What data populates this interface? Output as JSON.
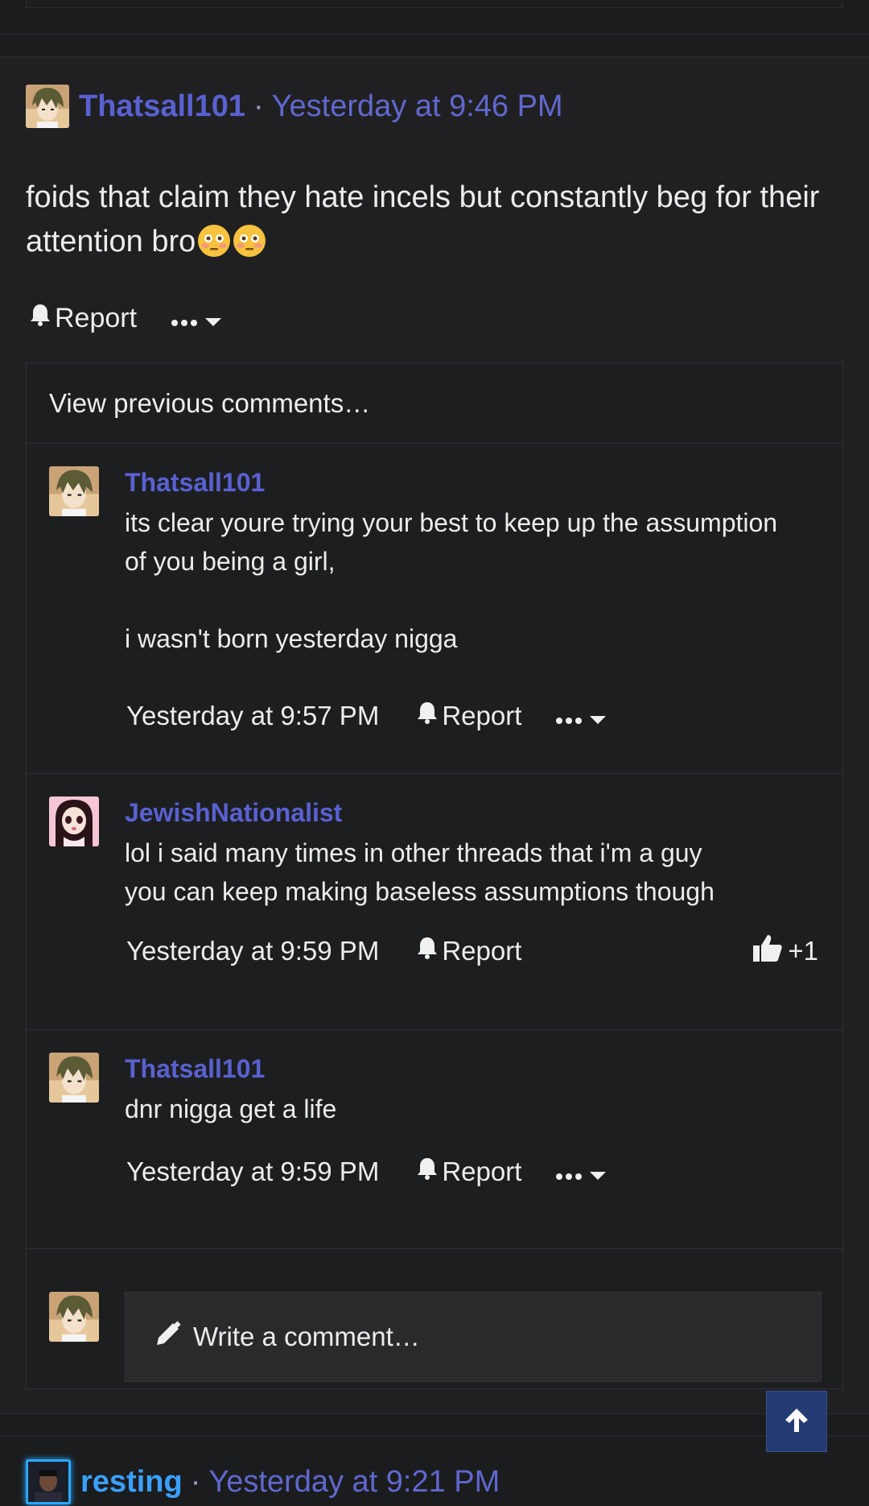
{
  "post": {
    "author": "Thatsall101",
    "separator": "·",
    "timestamp": "Yesterday at 9:46 PM",
    "body": "foids that claim they hate incels but constantly beg for their attention bro",
    "emojis": [
      "flushed-face-emoji",
      "flushed-face-emoji"
    ],
    "actions": {
      "report_label": "Report",
      "more_icon": "ellipsis-icon"
    }
  },
  "comments_section": {
    "view_previous": "View previous comments…",
    "items": [
      {
        "author": "Thatsall101",
        "text": "its clear youre trying your best to keep up the assumption\nof you being a girl,\n\ni wasn't born yesterday nigga",
        "timestamp": "Yesterday at 9:57 PM",
        "report_label": "Report"
      },
      {
        "author": "JewishNationalist",
        "text": "lol i said many times in other threads that i'm a guy\nyou can keep making baseless assumptions though",
        "timestamp": "Yesterday at 9:59 PM",
        "report_label": "Report",
        "reaction": "+1"
      },
      {
        "author": "Thatsall101",
        "text": "dnr nigga get a life",
        "timestamp": "Yesterday at 9:59 PM",
        "report_label": "Report"
      }
    ],
    "write_comment_placeholder": "Write a comment…"
  },
  "next_post": {
    "author": "resting",
    "separator": "·",
    "timestamp": "Yesterday at 9:21 PM"
  },
  "colors": {
    "username": "#5961d1",
    "background": "#1b1c1e",
    "scroll_top_button": "#233a73"
  }
}
